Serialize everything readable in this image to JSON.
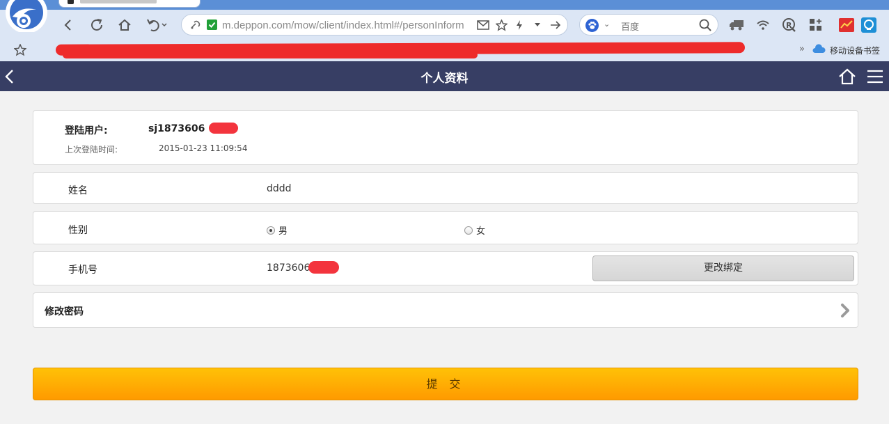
{
  "browser": {
    "address": "m.deppon.com/mow/client/index.html#/personInform",
    "search_placeholder": "百度",
    "bookmark_mobile": "移动设备书签",
    "bookmark_more": "»"
  },
  "header": {
    "title": "个人资料"
  },
  "user": {
    "login_label": "登陆用户:",
    "login_value": "sj1873606",
    "last_login_label": "上次登陆时间:",
    "last_login_value": "2015-01-23 11:09:54"
  },
  "name_row": {
    "label": "姓名",
    "value": "dddd"
  },
  "sex_row": {
    "label": "性别",
    "options": [
      {
        "label": "男",
        "selected": true
      },
      {
        "label": "女",
        "selected": false
      }
    ]
  },
  "phone_row": {
    "label": "手机号",
    "value": "1873606",
    "change_button": "更改绑定"
  },
  "password_row": {
    "label": "修改密码"
  },
  "submit_button": "提 交",
  "colors": {
    "header_bg": "#373e64",
    "submit_top": "#ffc107",
    "submit_bottom": "#ff9a00",
    "redaction": "#ee2b2b"
  }
}
